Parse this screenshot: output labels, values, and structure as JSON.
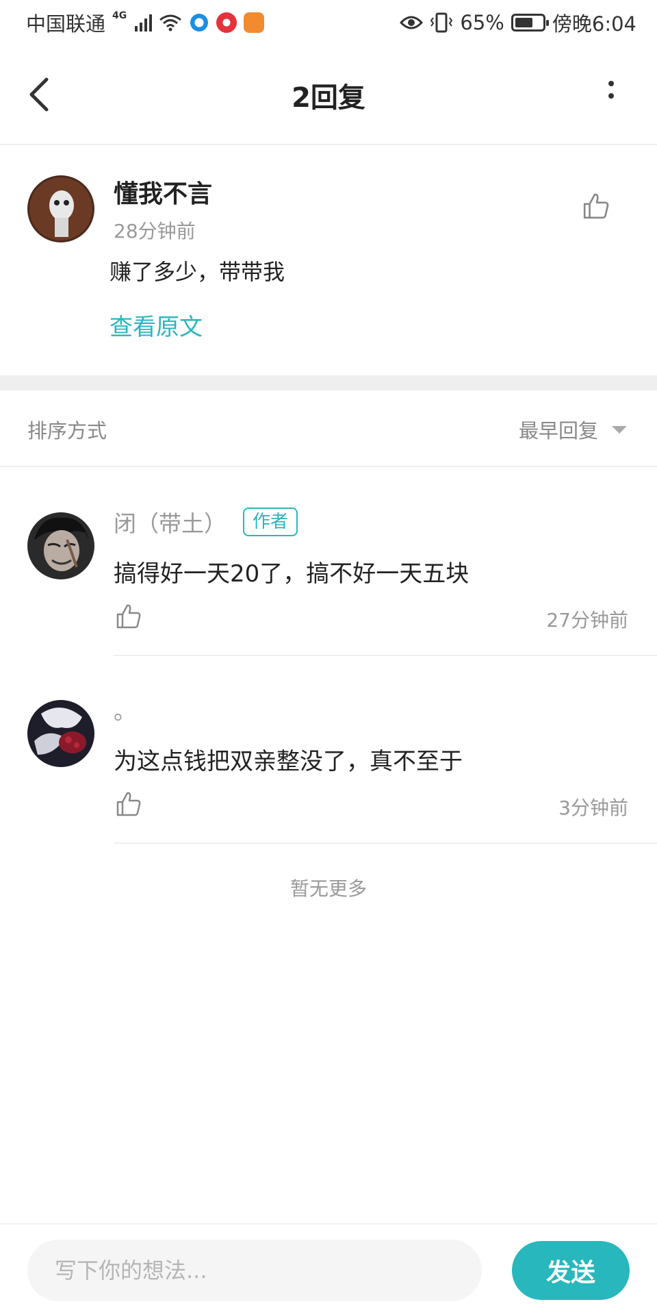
{
  "status": {
    "carrier": "中国联通",
    "network": "4G",
    "battery_text": "65%",
    "battery_level": 0.65,
    "time": "傍晚6:04"
  },
  "header": {
    "title": "2回复"
  },
  "original": {
    "username": "懂我不言",
    "time": "28分钟前",
    "text": "赚了多少，带带我",
    "view_original": "查看原文"
  },
  "sort": {
    "label": "排序方式",
    "value": "最早回复"
  },
  "replies": [
    {
      "username": "闭（带土）",
      "badge": "作者",
      "text": "搞得好一天20了，搞不好一天五块",
      "time": "27分钟前"
    },
    {
      "username": "。",
      "badge": "",
      "text": "为这点钱把双亲整没了，真不至于",
      "time": "3分钟前"
    }
  ],
  "footer_note": "暂无更多",
  "composer": {
    "placeholder": "写下你的想法...",
    "send_label": "发送"
  },
  "colors": {
    "accent": "#27b7bd"
  }
}
